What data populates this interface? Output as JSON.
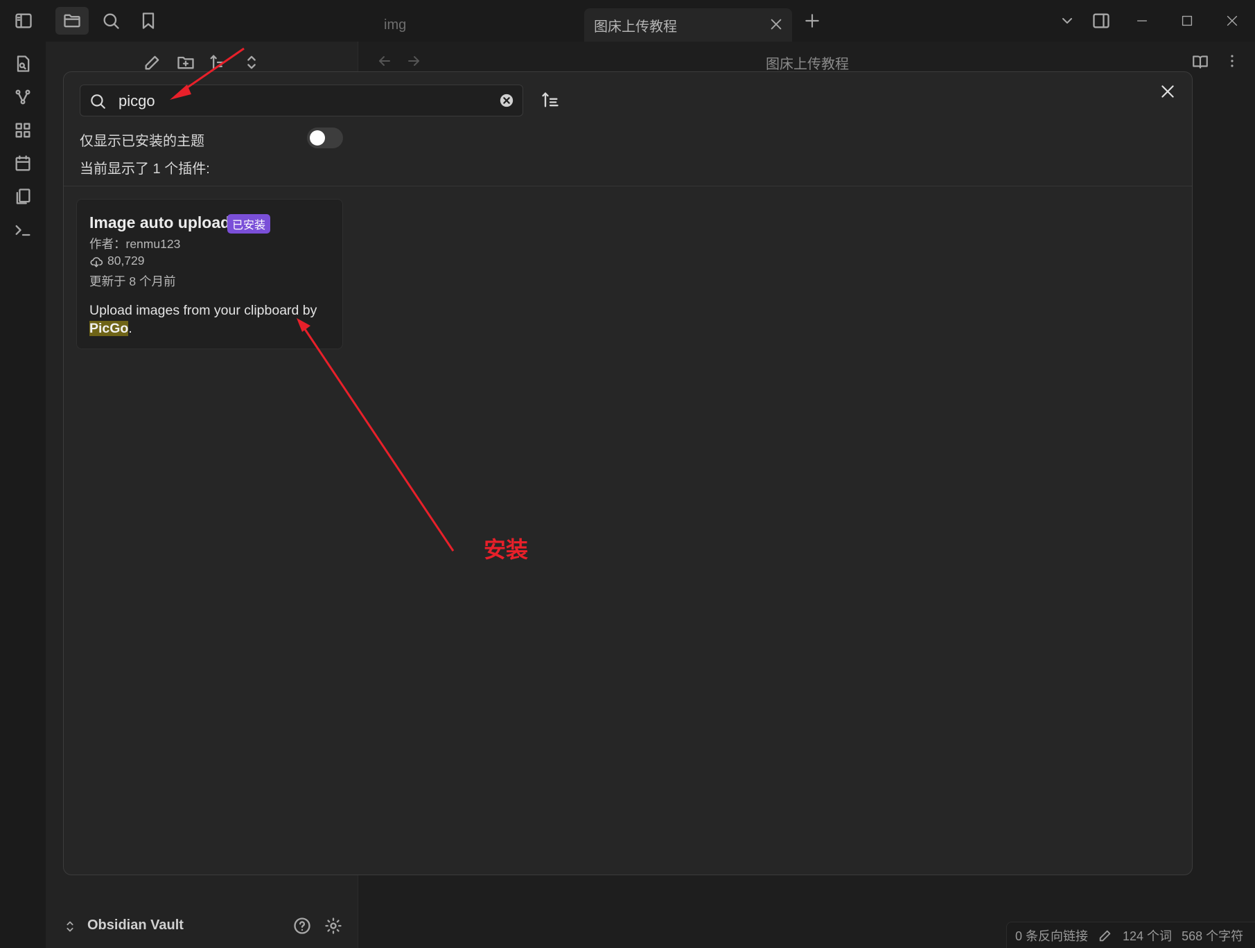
{
  "tabs": [
    {
      "label": "img",
      "active": false
    },
    {
      "label": "图床上传教程",
      "active": true
    }
  ],
  "editor": {
    "title": "图床上传教程"
  },
  "vault": {
    "name": "Obsidian Vault"
  },
  "modal": {
    "search": {
      "value": "picgo"
    },
    "toggle_label": "仅显示已安装的主题",
    "toggle_on": false,
    "result_count": "当前显示了 1 个插件:"
  },
  "plugin": {
    "name": "Image auto upload",
    "badge": "已安装",
    "author": "作者：renmu123",
    "downloads": "80,729",
    "updated": "更新于 8 个月前",
    "description_before": "Upload images from your clipboard by ",
    "description_highlight": "PicGo",
    "description_after": "."
  },
  "annotation": {
    "text": "安装",
    "color": "#e8202a"
  },
  "status": {
    "backlinks": "0 条反向链接",
    "words": "124 个词",
    "chars": "568 个字符"
  },
  "colors": {
    "accent": "#7a4fd8",
    "highlight": "#6f6417",
    "arrow": "#e8202a"
  }
}
